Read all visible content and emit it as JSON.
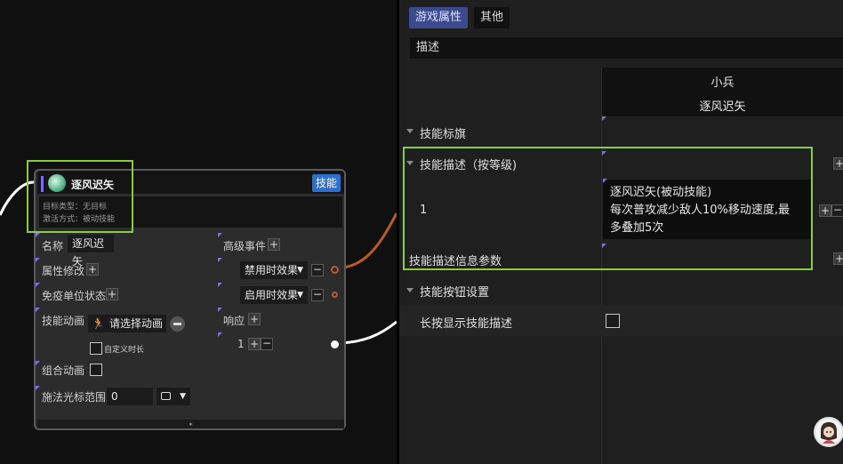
{
  "node": {
    "title": "逐风迟矢",
    "badge": "技能",
    "target_type": "目标类型：无目标",
    "activation": "激活方式：被动技能",
    "name_label": "名称",
    "name_value": "逐风迟矢",
    "attr_label": "属性修改",
    "immune_label": "免疫单位状态",
    "anim_label": "技能动画",
    "anim_select": "请选择动画",
    "custom_duration": "自定义时长",
    "combo_anim_label": "组合动画",
    "cast_range_label": "施法光标范围",
    "cast_range_value": "0",
    "advanced_label": "高级事件",
    "disable_effect": "禁用时效果",
    "enable_effect": "启用时效果",
    "response_label": "响应",
    "response_value": "1",
    "foot": "⁎"
  },
  "panel": {
    "tab_game": "游戏属性",
    "tab_other": "其他",
    "desc_section": "描述",
    "col_unit": "小兵",
    "col_skill": "逐风迟矢",
    "flag_label": "技能标旗",
    "level_desc_label": "技能描述（按等级)",
    "level_1": "1",
    "desc_line1": "逐风迟矢(被动技能)",
    "desc_line2": "每次普攻减少敌人10%移动速度,最",
    "desc_line3": "多叠加5次",
    "desc_params_label": "技能描述信息参数",
    "button_settings_label": "技能按钮设置",
    "long_press_label": "长按显示技能描述"
  },
  "colors": {
    "highlight": "#8ccc3f",
    "accent": "#7b6ee8",
    "badge": "#2d6fcc",
    "wire_orange": "#b85a2a",
    "wire_white": "#ffffff"
  }
}
